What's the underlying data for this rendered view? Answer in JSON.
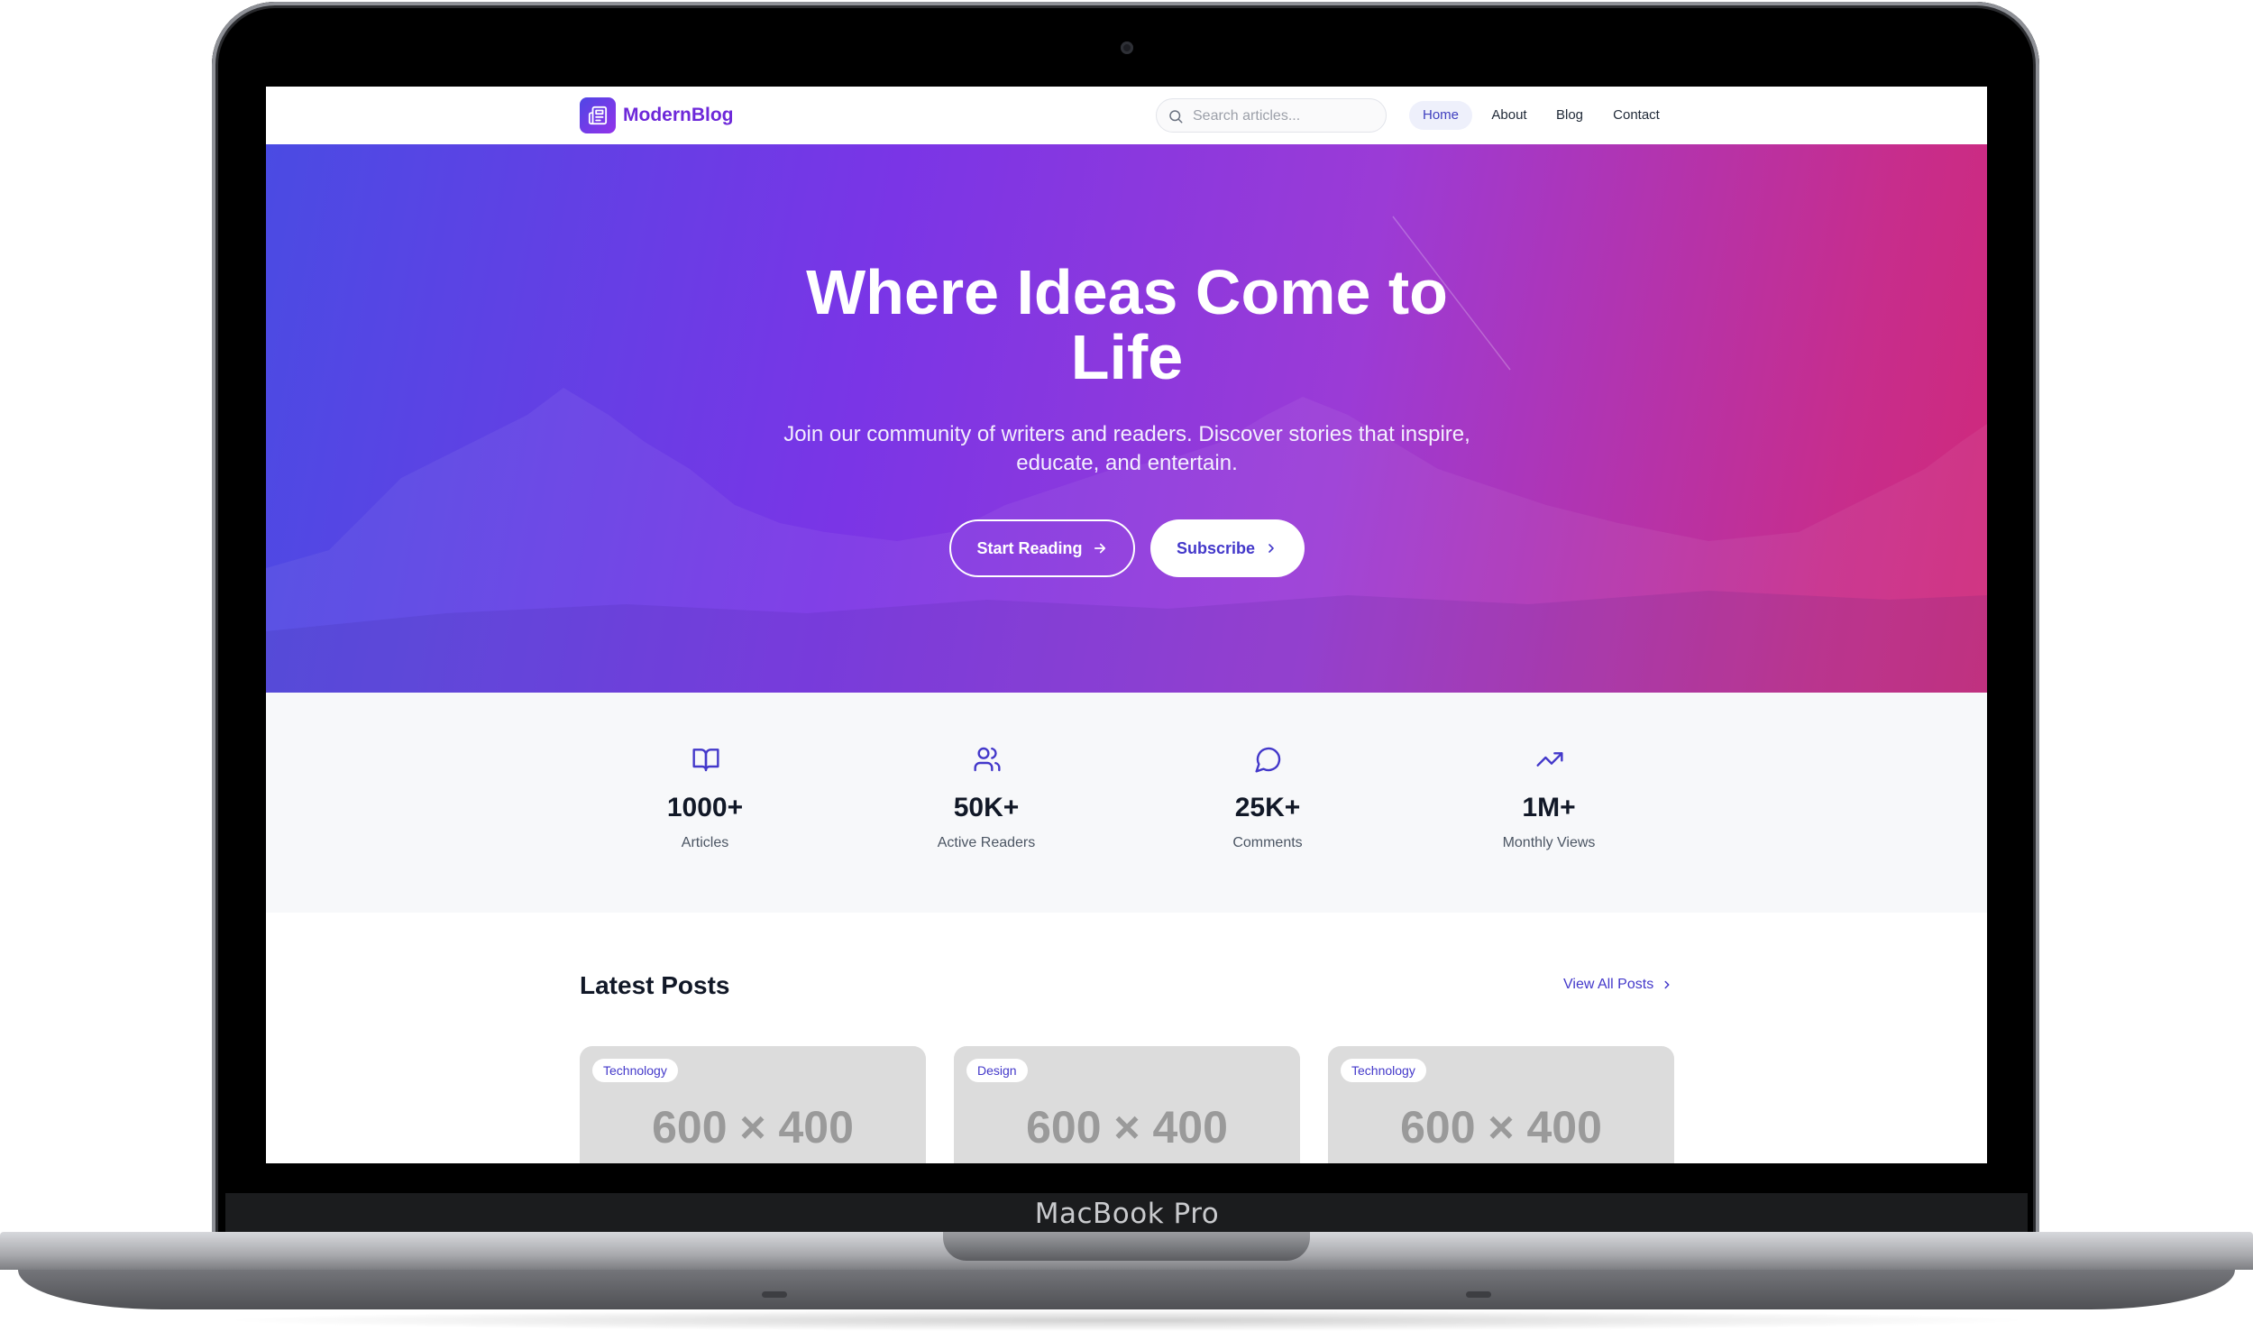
{
  "device": {
    "label": "MacBook Pro"
  },
  "nav": {
    "brand": "ModernBlog",
    "search_placeholder": "Search articles...",
    "links": [
      {
        "label": "Home",
        "active": true
      },
      {
        "label": "About",
        "active": false
      },
      {
        "label": "Blog",
        "active": false
      },
      {
        "label": "Contact",
        "active": false
      }
    ]
  },
  "hero": {
    "title": "Where Ideas Come to Life",
    "subtitle": "Join our community of writers and readers. Discover stories that inspire, educate, and entertain.",
    "primary_button": "Start Reading",
    "secondary_button": "Subscribe"
  },
  "stats": [
    {
      "icon": "book-open-icon",
      "value": "1000+",
      "label": "Articles"
    },
    {
      "icon": "users-icon",
      "value": "50K+",
      "label": "Active Readers"
    },
    {
      "icon": "message-circle-icon",
      "value": "25K+",
      "label": "Comments"
    },
    {
      "icon": "trending-up-icon",
      "value": "1M+",
      "label": "Monthly Views"
    }
  ],
  "latest": {
    "title": "Latest Posts",
    "view_all": "View All Posts",
    "cards": [
      {
        "tag": "Technology",
        "placeholder": "600 × 400"
      },
      {
        "tag": "Design",
        "placeholder": "600 × 400"
      },
      {
        "tag": "Technology",
        "placeholder": "600 × 400"
      }
    ]
  },
  "colors": {
    "accent": "#4338ca",
    "brand": "#6d28d9",
    "hero_gradient_start": "#4a4be3",
    "hero_gradient_end": "#d0297a",
    "stats_bg": "#f7f8fa"
  }
}
